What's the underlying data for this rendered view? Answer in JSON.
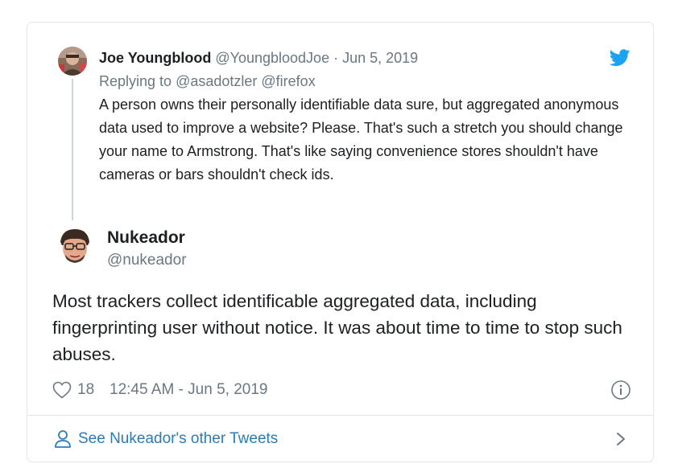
{
  "parent_tweet": {
    "avatar_icon": "user-photo-avatar",
    "name": "Joe Youngblood",
    "handle": "@YoungbloodJoe",
    "separator": "·",
    "date": "Jun 5, 2019",
    "replying_prefix": "Replying to",
    "replying_to": "@asadotzler @firefox",
    "text": "A person owns their personally identifiable data sure, but aggregated anonymous data used to improve a website? Please. That's such a stretch you should change your name to Armstrong. That's like saying convenience stores shouldn't have cameras or bars shouldn't check ids."
  },
  "main_tweet": {
    "avatar_icon": "cartoon-avatar",
    "name": "Nukeador",
    "handle": "@nukeador",
    "text": "Most trackers collect identificable aggregated data, including fingerprinting user without notice. It was about time to time to stop such abuses.",
    "like_icon": "heart-icon",
    "likes": "18",
    "timestamp": "12:45 AM - Jun 5, 2019",
    "info_icon": "info-icon"
  },
  "footer": {
    "icon": "person-icon",
    "see_more_label": "See Nukeador's other Tweets",
    "chevron_icon": "chevron-right-icon"
  },
  "brand": {
    "icon": "twitter-bird-icon",
    "color": "#1da1f2",
    "link_color": "#2b7bb9",
    "muted_color": "#697882",
    "text_color": "#1c2022"
  }
}
